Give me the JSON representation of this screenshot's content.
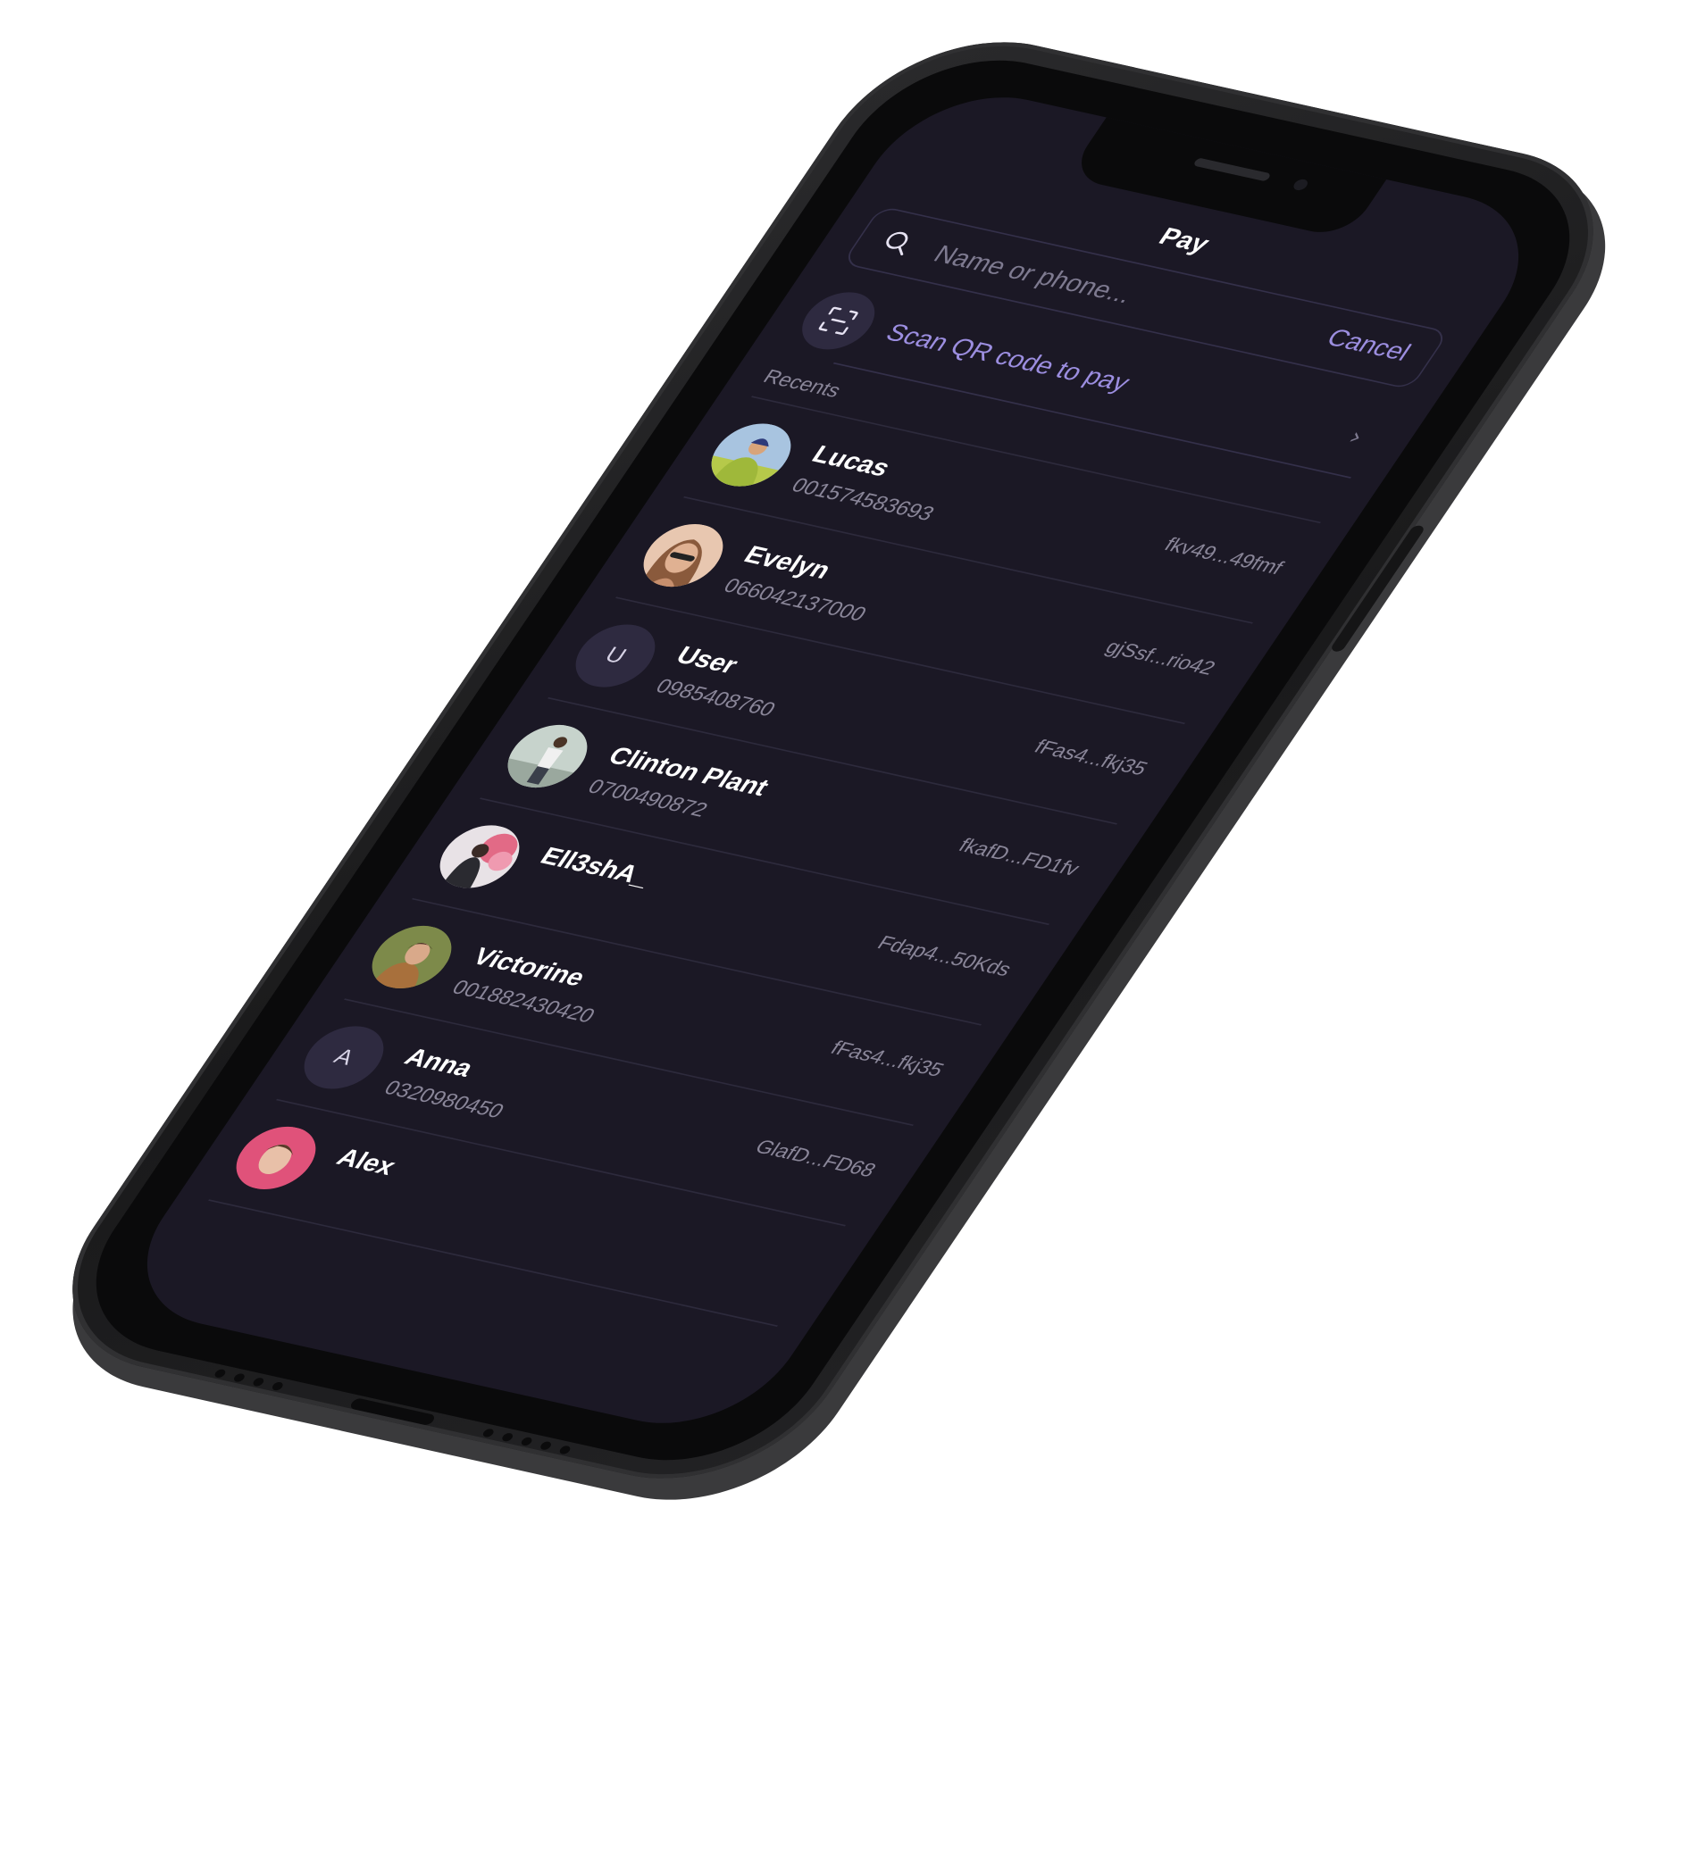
{
  "header": {
    "title": "Pay"
  },
  "search": {
    "placeholder": "Name or phone...",
    "cancel_label": "Cancel"
  },
  "scan": {
    "label": "Scan QR code to pay"
  },
  "recents": {
    "label": "Recents",
    "contacts": [
      {
        "name": "Lucas",
        "phone": "001574583693",
        "wallet": "fkv49...49fmf",
        "avatar": "photo"
      },
      {
        "name": "Evelyn",
        "phone": "066042137000",
        "wallet": "gjSsf...rio42",
        "avatar": "photo"
      },
      {
        "name": "User",
        "phone": "0985408760",
        "wallet": "fFas4...fkj35",
        "avatar": "U"
      },
      {
        "name": "Clinton Plant",
        "phone": "0700490872",
        "wallet": "fkafD...FD1fv",
        "avatar": "photo"
      },
      {
        "name": "Ell3shA_",
        "phone": "",
        "wallet": "Fdap4...50Kds",
        "avatar": "photo"
      },
      {
        "name": "Victorine",
        "phone": "001882430420",
        "wallet": "fFas4...fkj35",
        "avatar": "photo"
      },
      {
        "name": "Anna",
        "phone": "0320980450",
        "wallet": "GlafD...FD68",
        "avatar": "A"
      },
      {
        "name": "Alex",
        "phone": "",
        "wallet": "",
        "avatar": "photo"
      }
    ]
  },
  "colors": {
    "screen_bg": "#1b1825",
    "accent": "#9c8ee0",
    "text_primary": "#ffffff",
    "text_secondary": "#8a8699",
    "divider": "#2d2a3c",
    "initial_avatar_bg": "#2e2a40"
  },
  "icons": {
    "search": "search-icon",
    "scan": "qr-scan-icon",
    "chevron": "chevron-right-icon"
  }
}
